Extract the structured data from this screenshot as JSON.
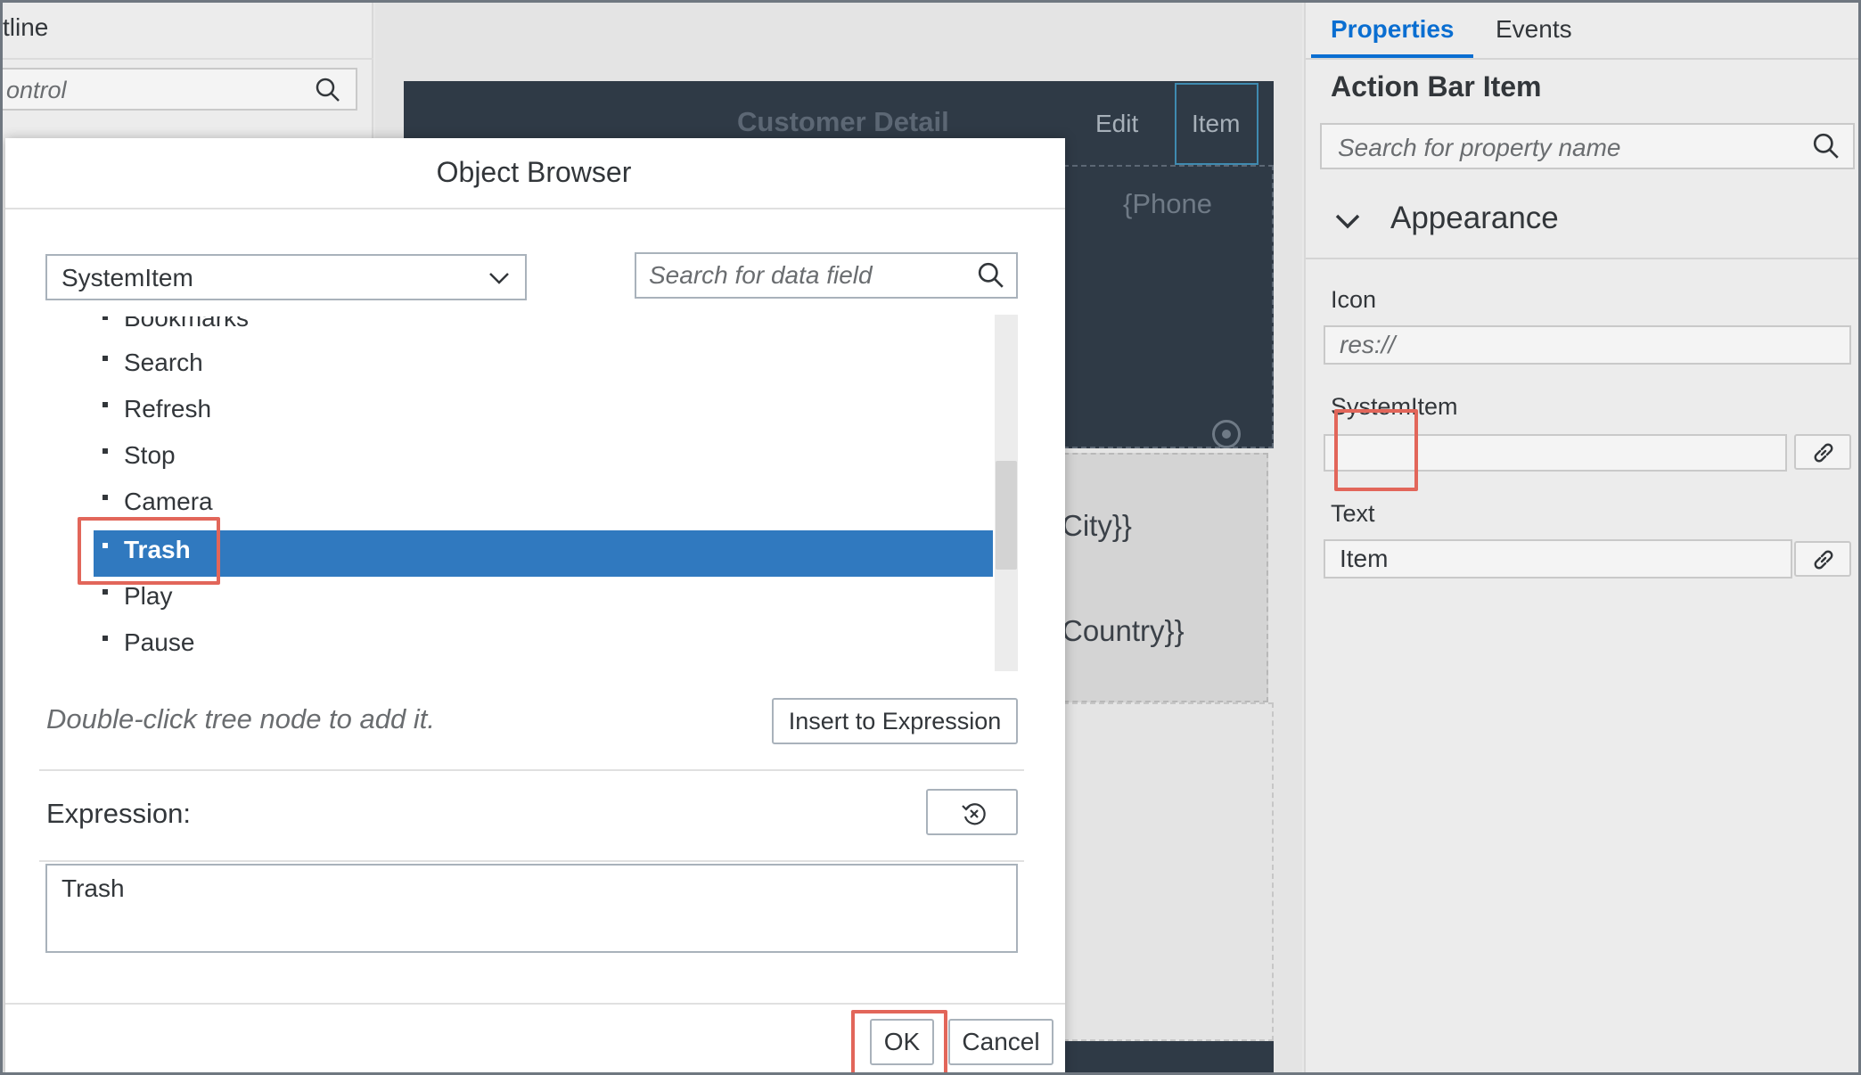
{
  "outline": {
    "title_fragment": "tline",
    "search_placeholder": "ontrol"
  },
  "canvas": {
    "header_title": "Customer Detail",
    "header_edit": "Edit",
    "header_item": "Item",
    "phone_placeholder": "{Phone",
    "city_placeholder": "City}}",
    "country_placeholder": "Country}}"
  },
  "properties": {
    "tabs": [
      {
        "label": "Properties",
        "active": true
      },
      {
        "label": "Events",
        "active": false
      }
    ],
    "heading": "Action Bar Item",
    "search_placeholder": "Search for property name",
    "section": "Appearance",
    "fields": {
      "icon": {
        "label": "Icon",
        "placeholder": "res://"
      },
      "system_item": {
        "label": "SystemItem",
        "value": ""
      },
      "text": {
        "label": "Text",
        "value": "Item"
      }
    }
  },
  "dialog": {
    "title": "Object Browser",
    "dropdown_value": "SystemItem",
    "search_placeholder": "Search for data field",
    "tree_items": [
      {
        "label": "Bookmarks",
        "selected": false
      },
      {
        "label": "Search",
        "selected": false
      },
      {
        "label": "Refresh",
        "selected": false
      },
      {
        "label": "Stop",
        "selected": false
      },
      {
        "label": "Camera",
        "selected": false
      },
      {
        "label": "Trash",
        "selected": true
      },
      {
        "label": "Play",
        "selected": false
      },
      {
        "label": "Pause",
        "selected": false
      }
    ],
    "hint": "Double-click tree node to add it.",
    "insert_button": "Insert to Expression",
    "expression_label": "Expression:",
    "expression_value": "Trash",
    "ok_button": "OK",
    "cancel_button": "Cancel"
  },
  "colors": {
    "accent": "#0a6ed1",
    "selection": "#3079bf",
    "highlight": "#e2665a",
    "shell_dark": "#2f3a46"
  }
}
